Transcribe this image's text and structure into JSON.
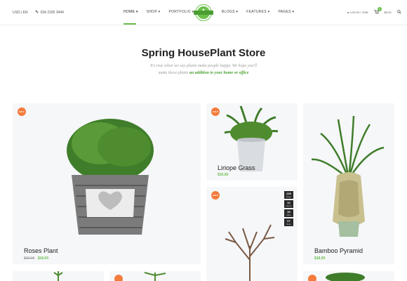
{
  "topbar": {
    "currency": "USD | EN",
    "phone": "034 2335 3444",
    "login": "LOG IN / JOIN",
    "cart_total": "$0.00",
    "cart_count": "0"
  },
  "nav_left": [
    "HOME ▾",
    "SHOP ▾",
    "PORTFOLIO ▾"
  ],
  "nav_right": [
    "BLOGS ▾",
    "FEATURES ▾",
    "PAGES ▾"
  ],
  "hero": {
    "title": "Spring HousePlant Store",
    "subtitle_line1": "It's true when we say plants make people happy. We hope you'll",
    "subtitle_line2_pre": "make these plants",
    "subtitle_highlight": "an addition to your home or office"
  },
  "products": {
    "roses": {
      "badge": "SALE",
      "name": "Roses Plant",
      "old_price": "$20.00",
      "price": "$18.00"
    },
    "liriope": {
      "badge": "SALE",
      "name": "Liriope Grass",
      "price": "$19.00"
    },
    "bamboo": {
      "name": "Bamboo Pyramid",
      "price": "$18.00"
    },
    "tree": {
      "badge": "SALE"
    }
  },
  "countdown": [
    {
      "n": "239",
      "u": "Days"
    },
    {
      "n": "12",
      "u": "Hours"
    },
    {
      "n": "49",
      "u": "Mins"
    },
    {
      "n": "07",
      "u": "Secs"
    }
  ],
  "colors": {
    "accent": "#6abf4b",
    "sale": "#f47b3b"
  }
}
